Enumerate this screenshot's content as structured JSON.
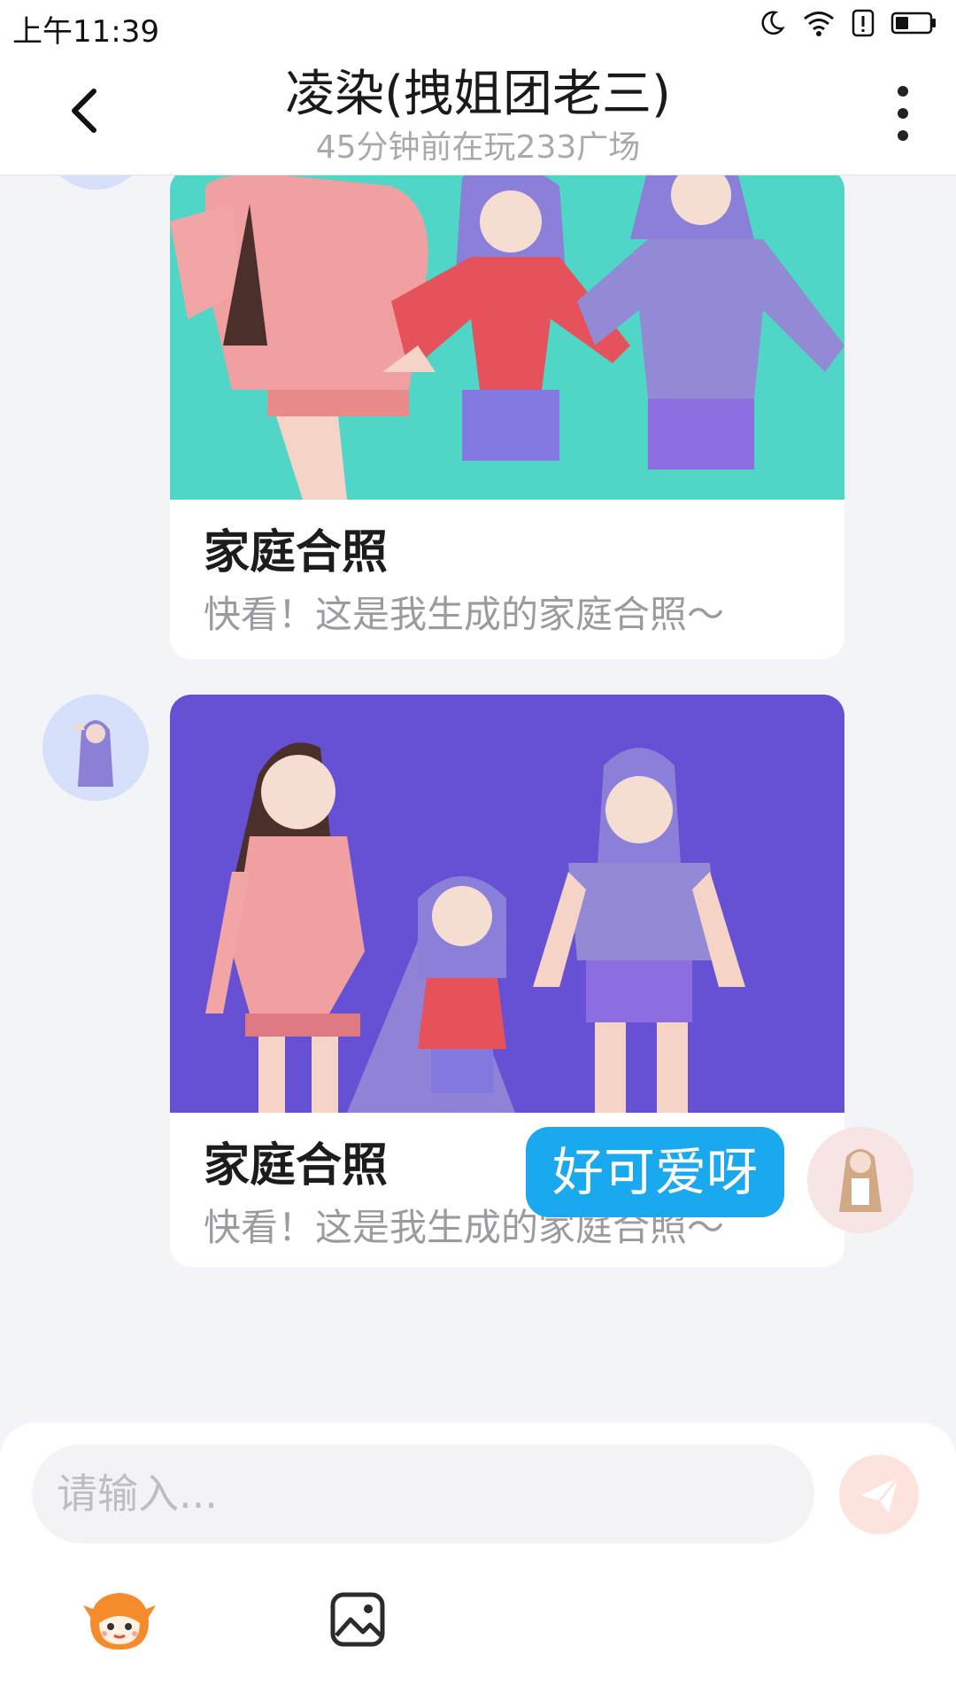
{
  "status_bar": {
    "time": "上午11:39",
    "icons": [
      "moon-icon",
      "wifi-icon",
      "alert-icon",
      "battery-icon"
    ]
  },
  "header": {
    "back_icon": "back-arrow-icon",
    "title": "凌染(拽姐团老三)",
    "subtitle": "45分钟前在玩233广场",
    "more_icon": "more-vertical-icon"
  },
  "messages": [
    {
      "sender": "other",
      "type": "card",
      "image_bg": "#50d6c6",
      "title": "家庭合照",
      "description": "快看！这是我生成的家庭合照～"
    },
    {
      "sender": "other",
      "type": "card",
      "image_bg": "#6650d3",
      "title": "家庭合照",
      "description": "快看！这是我生成的家庭合照～"
    },
    {
      "sender": "self",
      "type": "text",
      "text": "好可爱呀"
    }
  ],
  "composer": {
    "placeholder": "请输入...",
    "send_icon": "send-icon",
    "tools": [
      "mascot-emoji-icon",
      "image-icon"
    ]
  },
  "colors": {
    "accent": "#1aa8ef",
    "send_button": "#fde3de",
    "background": "#f3f4f8",
    "card1_bg": "#50d6c6",
    "card2_bg": "#6650d3"
  }
}
